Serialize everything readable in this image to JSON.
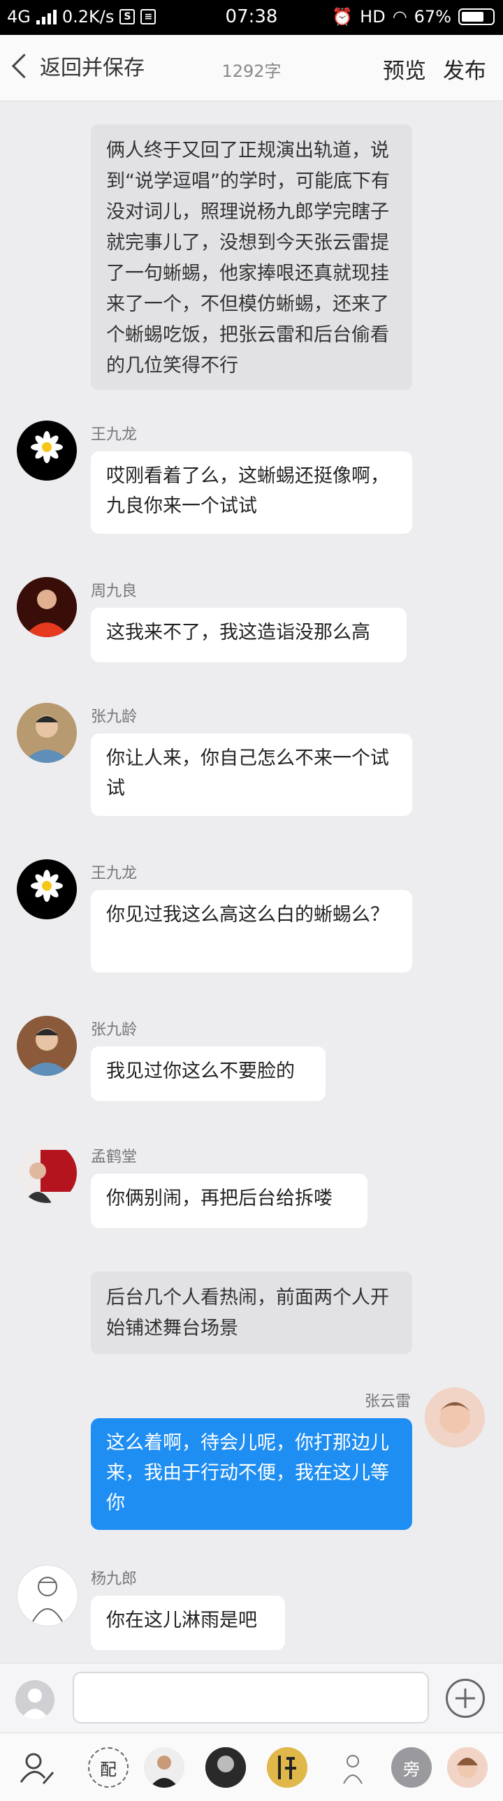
{
  "status_bar": {
    "network": "4G",
    "speed": "0.2K/s",
    "time": "07:38",
    "hd": "HD",
    "battery": "67%"
  },
  "nav": {
    "back_label": "返回并保存",
    "char_count": "1292字",
    "preview_label": "预览",
    "publish_label": "发布"
  },
  "messages": [
    {
      "type": "narration",
      "text": "俩人终于又回了正规演出轨道，说到“说学逗唱”的学时，可能底下有没对词儿，照理说杨九郎学完瞎子就完事儿了，没想到今天张云雷提了一句蜥蜴，他家捧哏还真就现挂来了一个，不但模仿蜥蜴，还来了个蜥蜴吃饭，把张云雷和后台偷看的几位笑得不行"
    },
    {
      "type": "chat",
      "name": "王九龙",
      "text": "哎刚看着了么，这蜥蜴还挺像啊，九良你来一个试试"
    },
    {
      "type": "chat",
      "name": "周九良",
      "text": "这我来不了，我这造诣没那么高"
    },
    {
      "type": "chat",
      "name": "张九龄",
      "text": "你让人来，你自己怎么不来一个试试"
    },
    {
      "type": "chat",
      "name": "王九龙",
      "text": "你见过我这么高这么白的蜥蜴么？"
    },
    {
      "type": "chat",
      "name": "张九龄",
      "text": "我见过你这么不要脸的"
    },
    {
      "type": "chat",
      "name": "孟鹤堂",
      "text": "你俩别闹，再把后台给拆喽"
    },
    {
      "type": "narration",
      "text": "后台几个人看热闹，前面两个人开始铺述舞台场景"
    },
    {
      "type": "chat-right",
      "name": "张云雷",
      "text": "这么着啊，待会儿呢，你打那边儿来，我由于行动不便，我在这儿等你"
    },
    {
      "type": "chat",
      "name": "杨九郎",
      "text": "你在这儿淋雨是吧"
    }
  ],
  "composer": {
    "placeholder": ""
  },
  "role_bar": {
    "pei_label": "配",
    "pang_label": "旁"
  },
  "colors": {
    "accent": "#1f8ef2",
    "narration_bg": "#e2e1e4"
  }
}
